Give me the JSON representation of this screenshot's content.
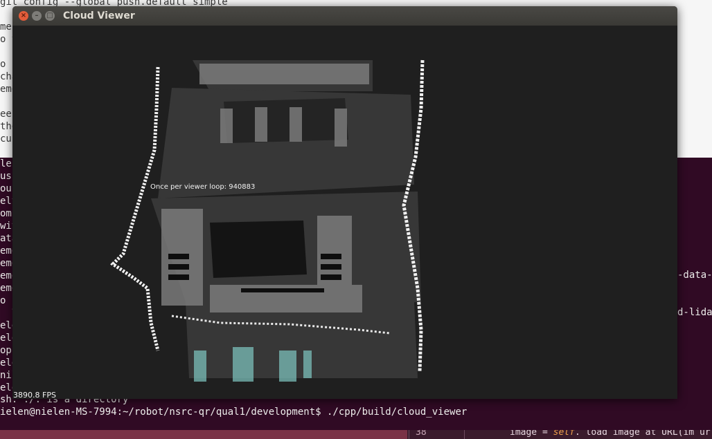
{
  "terminal": {
    "top_line": "git config --global push.default simple",
    "left_fragments_light": [
      "men",
      "o t",
      "",
      "o c",
      "cha",
      "emo",
      "",
      "ee",
      "the",
      "cur"
    ],
    "left_fragments_purple": [
      "len",
      "uss",
      "oun",
      "elt",
      "omp",
      "wit",
      "ata",
      "emo",
      "emo",
      "emo",
      "emo",
      "o h",
      "  7",
      "elen",
      "elen",
      "op",
      "elen",
      "nil",
      "elen"
    ],
    "right_fragments": [
      "-data-",
      "d-lida"
    ],
    "error_line": "sh: ./: is a directory",
    "prompt": "ielen@nielen-MS-7994:~/robot/nsrc-qr/qual1/development$ ./cpp/build/cloud_viewer"
  },
  "editor": {
    "line_number": "38",
    "code_prefix": "image = ",
    "code_keyword": "self",
    "code_rest": ". load image at URL(im ur"
  },
  "window": {
    "title": "Cloud Viewer",
    "close_glyph": "×",
    "minimize_glyph": "–",
    "maximize_glyph": "□"
  },
  "viewer": {
    "overlay_text": "Once per viewer loop: 940883",
    "fps_text": "3890.8 FPS"
  },
  "colors": {
    "terminal_purple": "#300a24",
    "viewport_bg": "#1f1f1f",
    "point_white": "#f0f0f0",
    "point_teal": "#7fc8c2"
  }
}
